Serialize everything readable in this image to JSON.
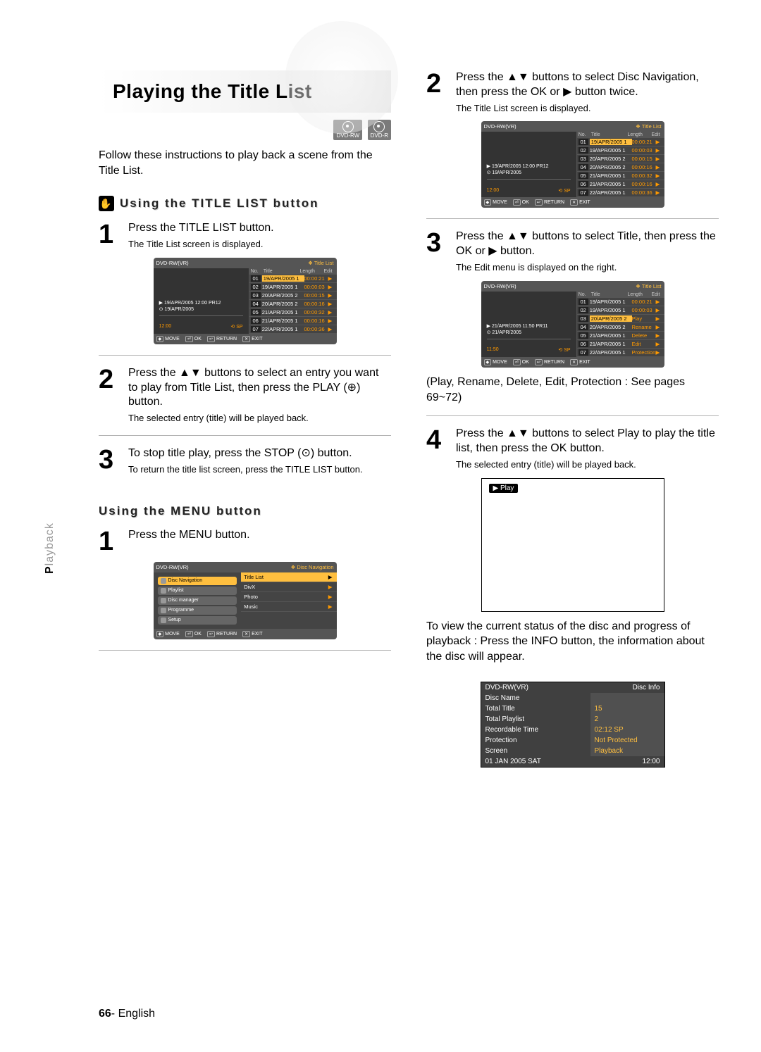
{
  "page": {
    "number": "66",
    "lang": "English"
  },
  "sidetab": {
    "prefix": "P",
    "rest": "layback"
  },
  "title": "Playing the Title List",
  "disc_chips": [
    "DVD-RW",
    "DVD-R"
  ],
  "intro": "Follow these instructions to play back a scene from the Title List.",
  "section1": {
    "heading": "Using the TITLE LIST button"
  },
  "section2": {
    "heading": "Using the MENU button"
  },
  "left": {
    "s1": {
      "line": "Press the TITLE LIST button.",
      "sub": "The Title List screen is displayed."
    },
    "s2": {
      "line": "Press the ▲▼ buttons to select an entry you want to play from Title List, then press the PLAY (⊕) button.",
      "sub": "The selected entry (title) will be played back."
    },
    "s3": {
      "line": "To stop title play, press the STOP (⊙) button.",
      "sub": "To return the title list screen, press the TITLE LIST button."
    },
    "m1": {
      "line": "Press the MENU button."
    }
  },
  "right": {
    "s2": {
      "line": "Press the ▲▼ buttons to select Disc Navigation, then press the OK or ▶ button twice.",
      "sub": "The Title List screen is displayed."
    },
    "s3": {
      "line": "Press the ▲▼ buttons to select Title, then press the OK or ▶ button.",
      "sub": "The Edit menu is displayed on the right."
    },
    "cross": "(Play, Rename, Delete, Edit, Protection : See pages 69~72)",
    "s4": {
      "line": "Press the ▲▼ buttons to select Play to play the title list, then press the OK button.",
      "sub": "The selected entry (title) will be played back."
    },
    "info_tip": "To view the current status of the disc and progress of playback : Press the INFO button, the information about the disc will appear."
  },
  "osd_nav": {
    "disc": "DVD-RW(VR)",
    "title": "Disc Navigation",
    "navbar": [
      "MOVE",
      "OK",
      "RETURN",
      "EXIT"
    ],
    "side": [
      "Disc Navigation",
      "Playlist",
      "Disc manager",
      "Programme",
      "Setup"
    ],
    "items": [
      "Title List",
      "DivX",
      "Photo",
      "Music"
    ]
  },
  "osd_tl": {
    "disc": "DVD-RW(VR)",
    "title": "Title List",
    "cols": [
      "No.",
      "Title",
      "Length",
      "Edit"
    ],
    "navbar": [
      "MOVE",
      "OK",
      "RETURN",
      "EXIT"
    ],
    "preview": {
      "line1": "19/APR/2005 12:00 PR12",
      "line2": "19/APR/2005",
      "time": "12:00",
      "mode": "SP"
    },
    "rows": [
      {
        "no": "01",
        "t": "19/APR/2005 1",
        "len": "00:00:21",
        "sel": true
      },
      {
        "no": "02",
        "t": "19/APR/2005 1",
        "len": "00:00:03"
      },
      {
        "no": "03",
        "t": "20/APR/2005 2",
        "len": "00:00:15"
      },
      {
        "no": "04",
        "t": "20/APR/2005 2",
        "len": "00:00:16"
      },
      {
        "no": "05",
        "t": "21/APR/2005 1",
        "len": "00:00:32"
      },
      {
        "no": "06",
        "t": "21/APR/2005 1",
        "len": "00:00:16"
      },
      {
        "no": "07",
        "t": "22/APR/2005 1",
        "len": "00:00:36"
      }
    ]
  },
  "osd_edit": {
    "disc": "DVD-RW(VR)",
    "title": "Title List",
    "cols": [
      "No.",
      "Title",
      "Length",
      "Edit"
    ],
    "navbar": [
      "MOVE",
      "OK",
      "RETURN",
      "EXIT"
    ],
    "preview": {
      "line1": "21/APR/2005 11:50 PR11",
      "line2": "21/APR/2005",
      "time": "11:50",
      "mode": "SP"
    },
    "rows": [
      {
        "no": "01",
        "t": "19/APR/2005 1",
        "len": "00:00:21"
      },
      {
        "no": "02",
        "t": "19/APR/2005 1",
        "len": "00:00:03"
      },
      {
        "no": "03",
        "t": "20/APR/2005 2",
        "edit": "Play",
        "sel": true
      },
      {
        "no": "04",
        "t": "20/APR/2005 2",
        "edit": "Rename"
      },
      {
        "no": "05",
        "t": "21/APR/2005 1",
        "edit": "Delete"
      },
      {
        "no": "06",
        "t": "21/APR/2005 1",
        "edit": "Edit"
      },
      {
        "no": "07",
        "t": "22/APR/2005 1",
        "edit": "Protection"
      }
    ]
  },
  "play_box": {
    "label": "▶ Play"
  },
  "disc_info": {
    "head_l": "DVD-RW(VR)",
    "head_r": "Disc Info",
    "rows": [
      {
        "l": "Disc Name",
        "r": ""
      },
      {
        "l": "Total Title",
        "r": "15"
      },
      {
        "l": "Total Playlist",
        "r": "2"
      },
      {
        "l": "Recordable Time",
        "r": "02:12  SP"
      },
      {
        "l": "Protection",
        "r": "Not Protected"
      },
      {
        "l": "Screen",
        "r": "Playback"
      }
    ],
    "date": "01 JAN 2005 SAT",
    "time": "12:00"
  }
}
